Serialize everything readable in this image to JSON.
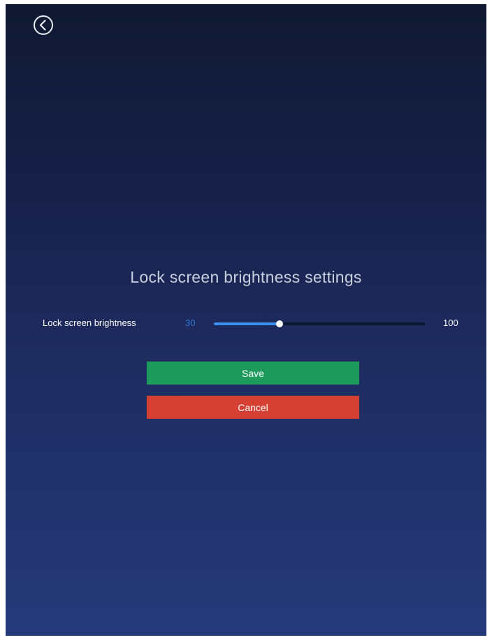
{
  "header": {
    "back_icon": "back-arrow-circle-icon"
  },
  "page": {
    "title": "Lock screen brightness settings"
  },
  "brightness": {
    "label": "Lock screen brightness",
    "value": "30",
    "max_label": "100",
    "level_fraction": 0.31,
    "fill_color": "#3a8ff0"
  },
  "actions": {
    "save_label": "Save",
    "save_color": "#1e9a5c",
    "cancel_label": "Cancel",
    "cancel_color": "#d63f33"
  }
}
